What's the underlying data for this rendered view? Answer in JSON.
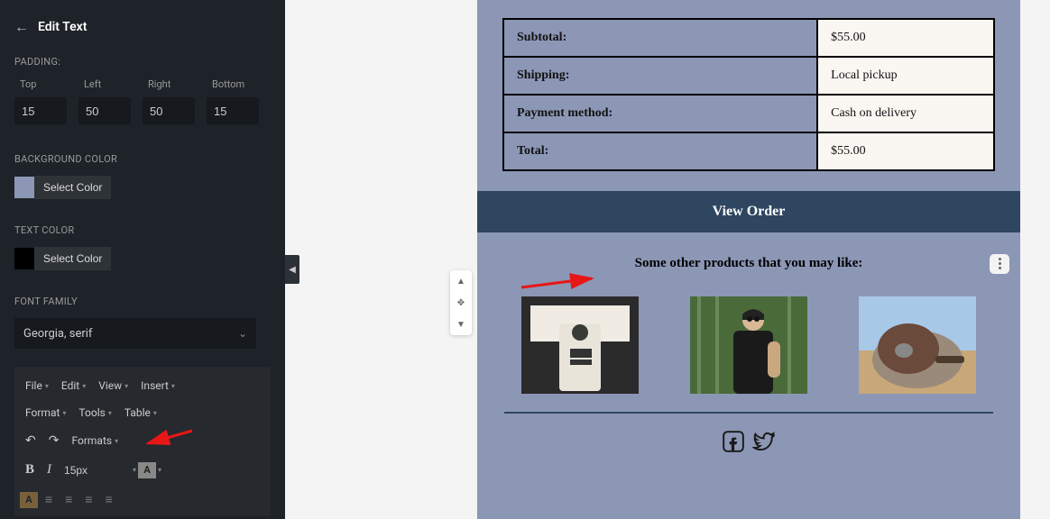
{
  "sidebar": {
    "title": "Edit Text",
    "padding_label": "PADDING:",
    "padding_fields": {
      "top_label": "Top",
      "top": "15",
      "left_label": "Left",
      "left": "50",
      "right_label": "Right",
      "right": "50",
      "bottom_label": "Bottom",
      "bottom": "15"
    },
    "bgcolor_label": "BACKGROUND COLOR",
    "bgcolor_btn": "Select Color",
    "textcolor_label": "TEXT COLOR",
    "textcolor_btn": "Select Color",
    "fontfamily_label": "FONT FAMILY",
    "fontfamily_value": "Georgia, serif",
    "toolbar": {
      "menu1": [
        "File",
        "Edit",
        "View",
        "Insert"
      ],
      "menu2": [
        "Format",
        "Tools",
        "Table"
      ],
      "formats": "Formats",
      "fontsize": "15px"
    }
  },
  "preview": {
    "order": [
      {
        "label": "Subtotal:",
        "value": "$55.00"
      },
      {
        "label": "Shipping:",
        "value": "Local pickup"
      },
      {
        "label": "Payment method:",
        "value": "Cash on delivery"
      },
      {
        "label": "Total:",
        "value": "$55.00"
      }
    ],
    "view_order_btn": "View Order",
    "suggest_title": "Some other products that you may like:"
  }
}
